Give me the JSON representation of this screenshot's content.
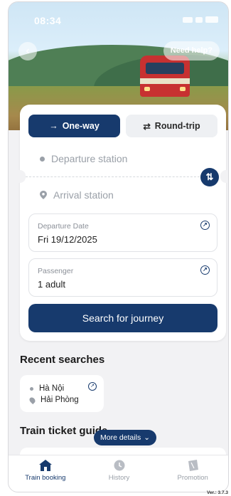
{
  "status_bar": {
    "time": "08:34"
  },
  "header": {
    "help_label": "Need help?"
  },
  "trip_type": {
    "one_way": {
      "label": "One-way",
      "icon": "arrow-right-icon"
    },
    "round_trip": {
      "label": "Round-trip",
      "icon": "swap-horizontal-icon"
    },
    "selected": "One-way"
  },
  "stations": {
    "departure_placeholder": "Departure station",
    "arrival_placeholder": "Arrival station"
  },
  "departure_date": {
    "label": "Departure Date",
    "value": "Fri 19/12/2025"
  },
  "passenger": {
    "label": "Passenger",
    "value": "1 adult"
  },
  "search_button": {
    "label": "Search for journey"
  },
  "recent": {
    "title": "Recent searches",
    "items": [
      {
        "from": "Hà Nội",
        "to": "Hải Phòng"
      }
    ]
  },
  "guide": {
    "title": "Train ticket guide",
    "more_label": "More details"
  },
  "tabs": [
    {
      "label": "Train booking",
      "icon": "home-icon",
      "active": true
    },
    {
      "label": "History",
      "icon": "clock-icon",
      "active": false
    },
    {
      "label": "Promotion",
      "icon": "ticket-icon",
      "active": false
    }
  ],
  "version": "Ver.: 3.7.3",
  "colors": {
    "primary": "#173a6d",
    "muted": "#9aa0a8",
    "background": "#f2f2f4"
  }
}
